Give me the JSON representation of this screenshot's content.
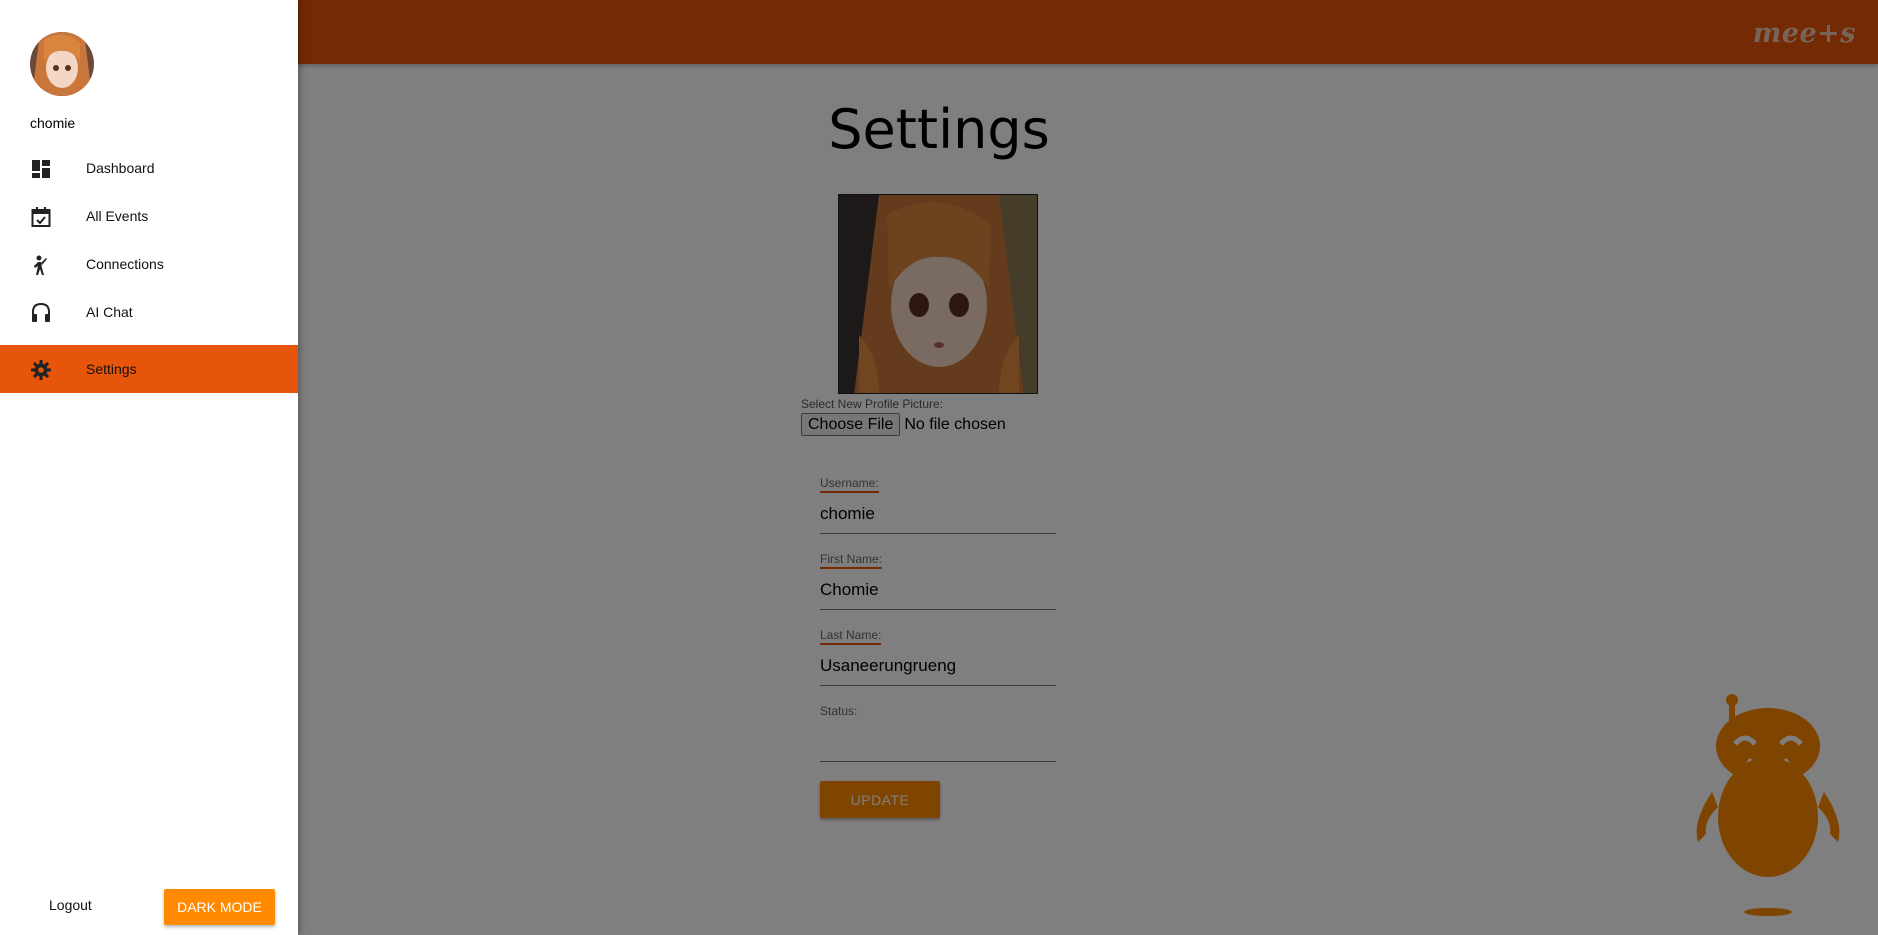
{
  "app": {
    "brand": "mee+s"
  },
  "drawer": {
    "username": "chomie",
    "nav_items": [
      {
        "label": "Dashboard",
        "icon": "dashboard-icon"
      },
      {
        "label": "All Events",
        "icon": "calendar-check-icon"
      },
      {
        "label": "Connections",
        "icon": "person-waving-icon"
      },
      {
        "label": "AI Chat",
        "icon": "headset-icon"
      },
      {
        "label": "Settings",
        "icon": "gear-icon",
        "active": true
      }
    ],
    "logout_label": "Logout",
    "dark_mode_label": "DARK MODE"
  },
  "settings": {
    "title": "Settings",
    "file_label": "Select New Profile Picture:",
    "choose_file_label": "Choose File",
    "no_file_text": "No file chosen",
    "fields": [
      {
        "label": "Username:",
        "value": "chomie"
      },
      {
        "label": "First Name:",
        "value": "Chomie"
      },
      {
        "label": "Last Name:",
        "value": "Usaneerungrueng"
      },
      {
        "label": "Status:",
        "value": ""
      }
    ],
    "update_label": "UPDATE"
  },
  "colors": {
    "accent": "#e6550a",
    "button": "#ff8a00",
    "robot": "#ff8a00"
  }
}
